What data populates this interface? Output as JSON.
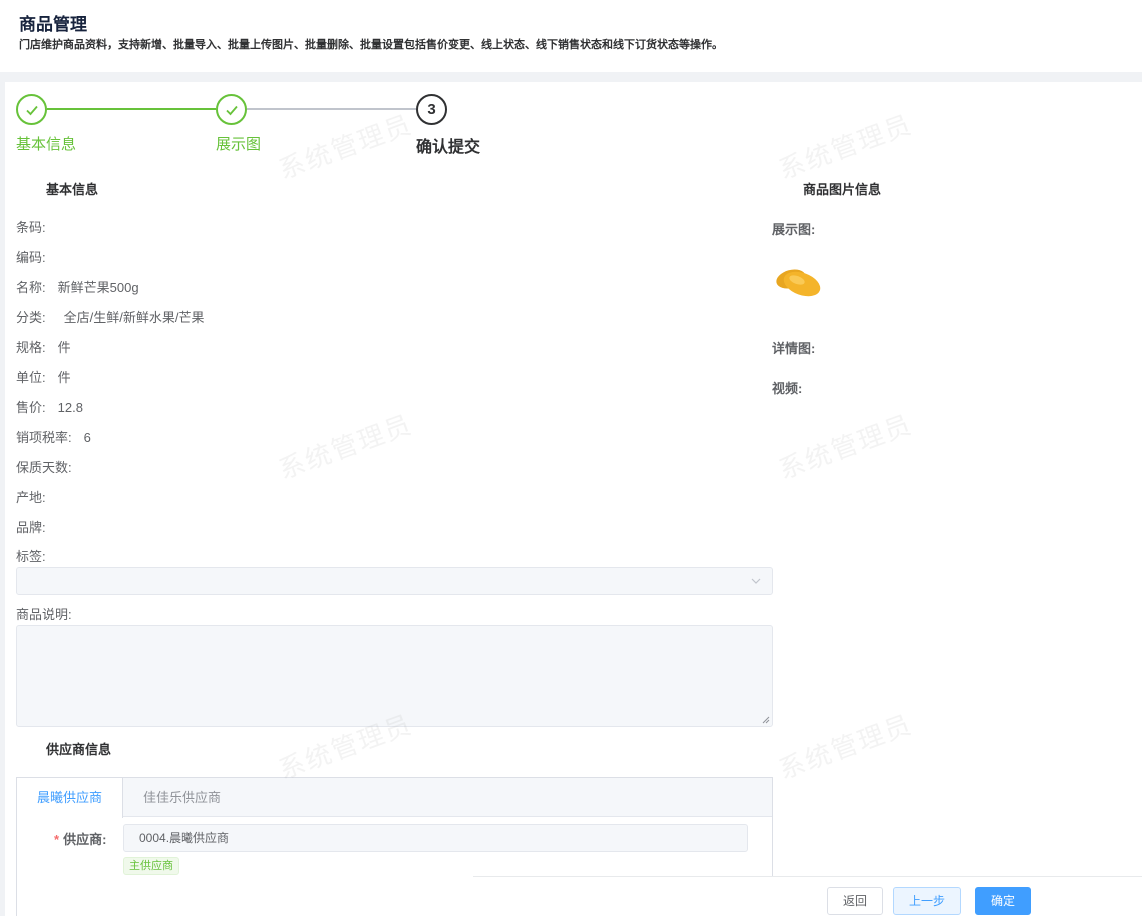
{
  "header": {
    "title": "商品管理",
    "description": "门店维护商品资料，支持新增、批量导入、批量上传图片、批量删除、批量设置包括售价变更、线上状态、线下销售状态和线下订货状态等操作。"
  },
  "watermark": "系统管理员",
  "steps": [
    {
      "number": "1",
      "label": "基本信息",
      "status": "done"
    },
    {
      "number": "2",
      "label": "展示图",
      "status": "done"
    },
    {
      "number": "3",
      "label": "确认提交",
      "status": "current"
    }
  ],
  "basic_info": {
    "title": "基本信息",
    "fields": [
      {
        "label": "条码:",
        "value": ""
      },
      {
        "label": "编码:",
        "value": ""
      },
      {
        "label": "名称:",
        "value": "新鲜芒果500g"
      },
      {
        "label": "分类:",
        "value": "全店/生鲜/新鲜水果/芒果"
      },
      {
        "label": "规格:",
        "value": "件"
      },
      {
        "label": "单位:",
        "value": "件"
      },
      {
        "label": "售价:",
        "value": "12.8"
      },
      {
        "label": "销项税率:",
        "value": "6"
      },
      {
        "label": "保质天数:",
        "value": ""
      },
      {
        "label": "产地:",
        "value": ""
      },
      {
        "label": "品牌:",
        "value": ""
      }
    ],
    "tags_label": "标签:",
    "tags_value": "",
    "description_label": "商品说明:",
    "description_value": ""
  },
  "supplier_info": {
    "title": "供应商信息",
    "tabs": [
      {
        "label": "晨曦供应商",
        "active": true
      },
      {
        "label": "佳佳乐供应商",
        "active": false
      }
    ],
    "supplier_label": "供应商:",
    "required_mark": "*",
    "supplier_value": "0004.晨曦供应商",
    "main_badge": "主供应商"
  },
  "image_info": {
    "title": "商品图片信息",
    "display_label": "展示图:",
    "detail_label": "详情图:",
    "video_label": "视频:"
  },
  "footer": {
    "back_label": "返回",
    "prev_label": "上一步",
    "confirm_label": "确定"
  },
  "colors": {
    "success": "#67c23a",
    "primary": "#409eff",
    "danger": "#f56c6c"
  }
}
